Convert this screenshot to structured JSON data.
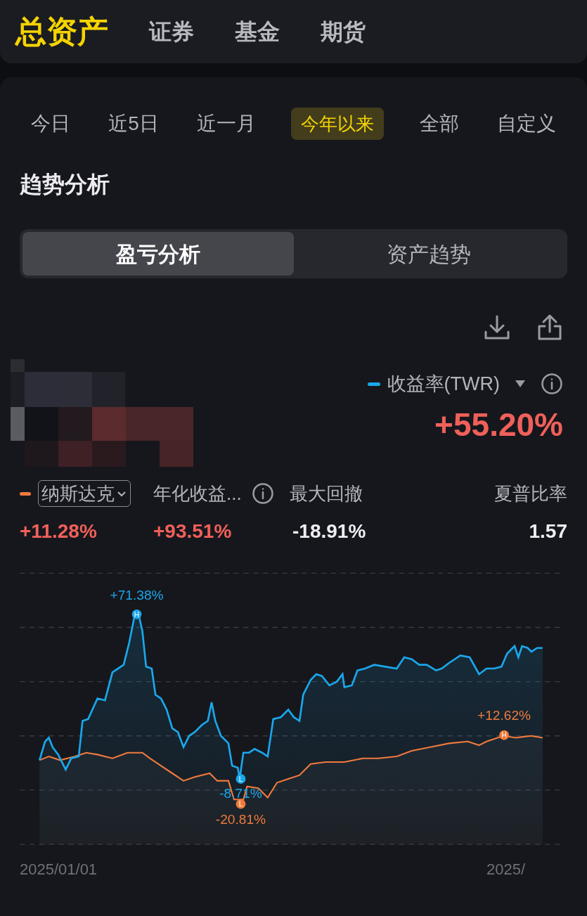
{
  "top_tabs": [
    {
      "label": "总资产",
      "selected": true
    },
    {
      "label": "证券",
      "selected": false
    },
    {
      "label": "基金",
      "selected": false
    },
    {
      "label": "期货",
      "selected": false
    }
  ],
  "periods": [
    {
      "label": "今日",
      "selected": false
    },
    {
      "label": "近5日",
      "selected": false
    },
    {
      "label": "近一月",
      "selected": false
    },
    {
      "label": "今年以来",
      "selected": true
    },
    {
      "label": "全部",
      "selected": false
    },
    {
      "label": "自定义",
      "selected": false
    }
  ],
  "section_title": "趋势分析",
  "segments": [
    {
      "label": "盈亏分析",
      "selected": true
    },
    {
      "label": "资产趋势",
      "selected": false
    }
  ],
  "return_metric": {
    "label": "收益率(TWR)",
    "color": "#1aa7ec",
    "value": "+55.20%"
  },
  "benchmark": {
    "label": "纳斯达克",
    "color": "#f07a3c",
    "value": "+11.28%"
  },
  "stats": [
    {
      "label": "年化收益...",
      "info": true,
      "value": "+93.51%",
      "color": "#f0605a"
    },
    {
      "label": "最大回撤",
      "info": false,
      "value": "-18.91%",
      "color": "#eeeef2"
    },
    {
      "label": "夏普比率",
      "info": false,
      "value": "1.57",
      "color": "#eeeef2"
    }
  ],
  "chart": {
    "annotations": [
      {
        "text": "+71.38%",
        "marker": "H",
        "color": "#1aa7ec"
      },
      {
        "text": "-8.71%",
        "marker": "L",
        "color": "#1aa7ec"
      },
      {
        "text": "-20.81%",
        "marker": "L",
        "color": "#f07a3c"
      },
      {
        "text": "+12.62%",
        "marker": "H",
        "color": "#f07a3c"
      }
    ],
    "start_date": "2025/01/01",
    "end_date": "2025/"
  }
}
